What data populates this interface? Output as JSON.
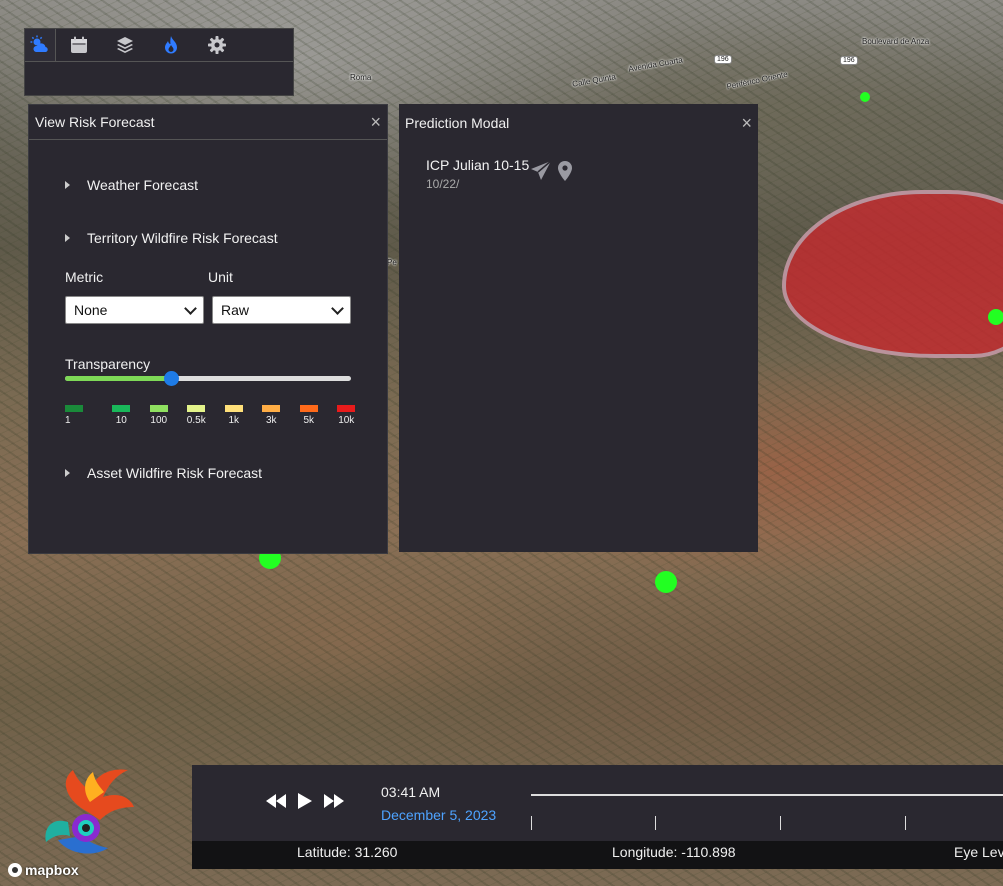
{
  "map": {
    "labels": [
      "Boulevard de Anza",
      "Avenida Cuarta",
      "Calle Quinta",
      "Periférico Oriente",
      "Roma",
      "Pe"
    ],
    "shield": "196"
  },
  "toolbar": {
    "icons": [
      "weather-icon",
      "calendar-icon",
      "layers-icon",
      "fire-icon",
      "gear-icon"
    ]
  },
  "risk_panel": {
    "title": "View Risk Forecast",
    "close": "×",
    "sections": {
      "weather": "Weather Forecast",
      "territory": "Territory Wildfire Risk Forecast",
      "asset": "Asset Wildfire Risk Forecast"
    },
    "metric_label": "Metric",
    "unit_label": "Unit",
    "metric_value": "None",
    "unit_value": "Raw",
    "transparency_label": "Transparency",
    "transparency_value": 0.37,
    "legend": [
      {
        "label": "1",
        "color": "#1a8a3a"
      },
      {
        "label": "10",
        "color": "#19b85a"
      },
      {
        "label": "100",
        "color": "#8fe060"
      },
      {
        "label": "0.5k",
        "color": "#e3f38a"
      },
      {
        "label": "1k",
        "color": "#ffe07a"
      },
      {
        "label": "3k",
        "color": "#ffad45"
      },
      {
        "label": "5k",
        "color": "#ff6a1a"
      },
      {
        "label": "10k",
        "color": "#e81b1b"
      }
    ]
  },
  "prediction_panel": {
    "title": "Prediction Modal",
    "close": "×",
    "item_name": "ICP Julian 10-15",
    "item_date": "10/22/"
  },
  "timeline": {
    "time": "03:41 AM",
    "date": "December 5, 2023"
  },
  "coords": {
    "latitude": "Latitude: 31.260",
    "longitude": "Longitude: -110.898",
    "eye": "Eye Lev"
  },
  "attribution": "mapbox",
  "colors": {
    "panel_bg": "#2a2830",
    "accent": "#4ea3ff",
    "fire_active": "#2f7bff",
    "burn_area": "#c8282d",
    "point": "#22ff22"
  }
}
